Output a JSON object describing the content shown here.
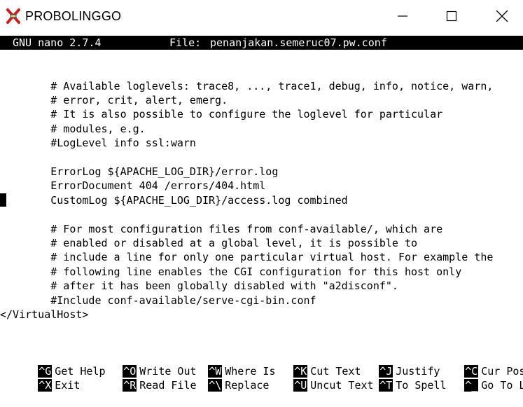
{
  "window": {
    "title": "PROBOLINGGO",
    "icon": "putty-x-icon",
    "controls": [
      "minimize-icon",
      "maximize-icon",
      "close-icon"
    ]
  },
  "nano": {
    "version": "GNU nano 2.7.4",
    "file_label": "File:",
    "file_name": "penanjakan.semeruc07.pw.conf"
  },
  "lines": [
    "        # Available loglevels: trace8, ..., trace1, debug, info, notice, warn,",
    "        # error, crit, alert, emerg.",
    "        # It is also possible to configure the loglevel for particular",
    "        # modules, e.g.",
    "        #LogLevel info ssl:warn",
    "",
    "        ErrorLog ${APACHE_LOG_DIR}/error.log",
    "        ErrorDocument 404 /errors/404.html",
    "        CustomLog ${APACHE_LOG_DIR}/access.log combined",
    "",
    "        # For most configuration files from conf-available/, which are",
    "        # enabled or disabled at a global level, it is possible to",
    "        # include a line for only one particular virtual host. For example the",
    "        # following line enables the CGI configuration for this host only",
    "        # after it has been globally disabled with \"a2disconf\".",
    "        #Include conf-available/serve-cgi-bin.conf",
    "</VirtualHost>"
  ],
  "shortcuts": [
    {
      "key": "^G",
      "label": "Get Help"
    },
    {
      "key": "^O",
      "label": "Write Out"
    },
    {
      "key": "^W",
      "label": "Where Is"
    },
    {
      "key": "^K",
      "label": "Cut Text"
    },
    {
      "key": "^J",
      "label": "Justify"
    },
    {
      "key": "^C",
      "label": "Cur Pos"
    },
    {
      "key": "^X",
      "label": "Exit"
    },
    {
      "key": "^R",
      "label": "Read File"
    },
    {
      "key": "^\\",
      "label": "Replace"
    },
    {
      "key": "^U",
      "label": "Uncut Text"
    },
    {
      "key": "^T",
      "label": "To Spell"
    },
    {
      "key": "^_",
      "label": "Go To Line"
    }
  ]
}
